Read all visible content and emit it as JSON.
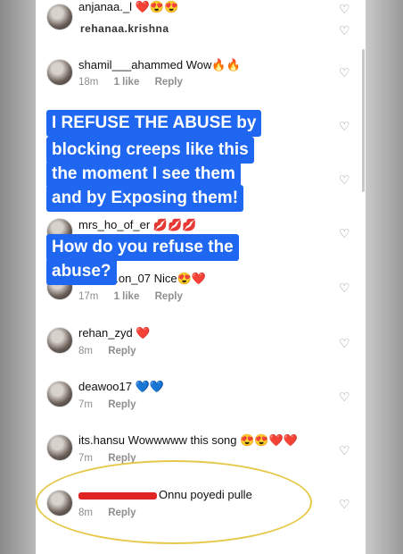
{
  "overlay": {
    "line1": "anjanaa._l",
    "line2": "rehanaa.krishna"
  },
  "comments": [
    {
      "user": "shamil___ahammed",
      "text": "Wow🔥🔥",
      "time": "18m",
      "likes": "1 like",
      "reply": "Reply"
    },
    {
      "user": "mrs_ho_of_er",
      "text": "💋💋💋",
      "time": "",
      "likes": "",
      "reply": ""
    },
    {
      "user": "...on_07",
      "text": "Nice😍❤️",
      "time": "17m",
      "likes": "1 like",
      "reply": "Reply"
    },
    {
      "user": "rehan_zyd",
      "text": "❤️",
      "time": "8m",
      "likes": "",
      "reply": "Reply"
    },
    {
      "user": "deawoo17",
      "text": "💙💙",
      "time": "7m",
      "likes": "",
      "reply": "Reply"
    },
    {
      "user": "its.hansu",
      "text": "Wowwwww this song 😍😍❤️❤️",
      "time": "7m",
      "likes": "",
      "reply": "Reply"
    },
    {
      "user": "",
      "text": "Onnu poyedi pulle",
      "time": "8m",
      "likes": "",
      "reply": "Reply"
    }
  ],
  "story_text": {
    "main_lines": [
      "I REFUSE THE ABUSE by",
      "blocking creeps like this",
      "the moment I see them",
      "and by Exposing them!"
    ],
    "question_lines": [
      "How do you refuse the",
      "abuse?"
    ]
  },
  "colors": {
    "accent": "#1f67f0",
    "highlight": "#e6c94b",
    "redaction": "#e02424"
  },
  "icons": {
    "like": "heart-outline-icon"
  }
}
